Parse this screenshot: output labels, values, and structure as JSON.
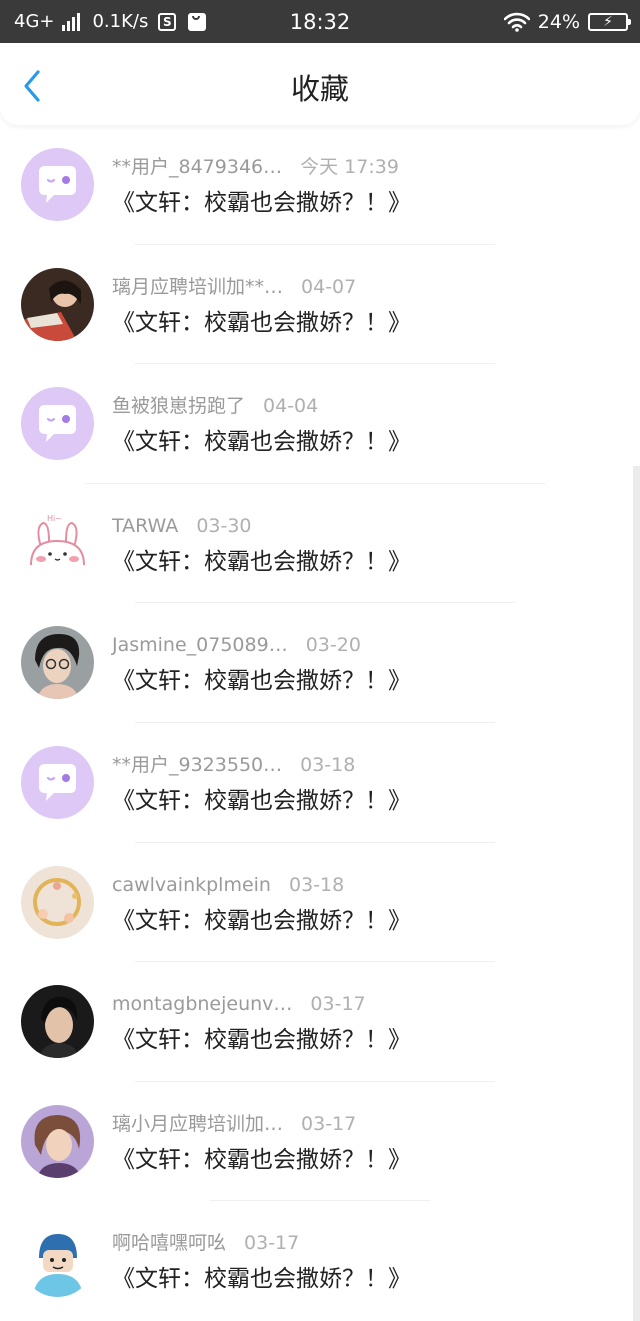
{
  "status_bar": {
    "network": "4G+",
    "speed": "0.1K/s",
    "box_icon_letter": "S",
    "time": "18:32",
    "battery_percent": "24%",
    "bg_color": "#3a3a3a"
  },
  "header": {
    "title": "收藏",
    "back_icon": "chevron-left-icon",
    "accent_color": "#2a9ae8"
  },
  "list": {
    "items": [
      {
        "user": "**用户_8479346…",
        "date": "今天 17:39",
        "title": "《文轩：校霸也会撒娇？！》",
        "avatar": "bubble"
      },
      {
        "user": "璃月应聘培训加**…",
        "date": "04-07",
        "title": "《文轩：校霸也会撒娇？！》",
        "avatar": "photo-girl-reading"
      },
      {
        "user": "鱼被狼崽拐跑了",
        "date": "04-04",
        "title": "《文轩：校霸也会撒娇？！》",
        "avatar": "bubble"
      },
      {
        "user": "TARWA",
        "date": "03-30",
        "title": "《文轩：校霸也会撒娇？！》",
        "avatar": "bunny"
      },
      {
        "user": "Jasmine_075089…",
        "date": "03-20",
        "title": "《文轩：校霸也会撒娇？！》",
        "avatar": "photo-girl-glasses"
      },
      {
        "user": "**用户_9323550…",
        "date": "03-18",
        "title": "《文轩：校霸也会撒娇？！》",
        "avatar": "bubble"
      },
      {
        "user": "cawlvainkplmein",
        "date": "03-18",
        "title": "《文轩：校霸也会撒娇？！》",
        "avatar": "photo-jewelry"
      },
      {
        "user": "montagbnejeunv…",
        "date": "03-17",
        "title": "《文轩：校霸也会撒娇？！》",
        "avatar": "photo-man"
      },
      {
        "user": "璃小月应聘培训加…",
        "date": "03-17",
        "title": "《文轩：校霸也会撒娇？！》",
        "avatar": "illustration-girl"
      },
      {
        "user": "啊哈嘻嘿呵吆",
        "date": "03-17",
        "title": "《文轩：校霸也会撒娇？！》",
        "avatar": "cartoon-blue"
      }
    ]
  }
}
